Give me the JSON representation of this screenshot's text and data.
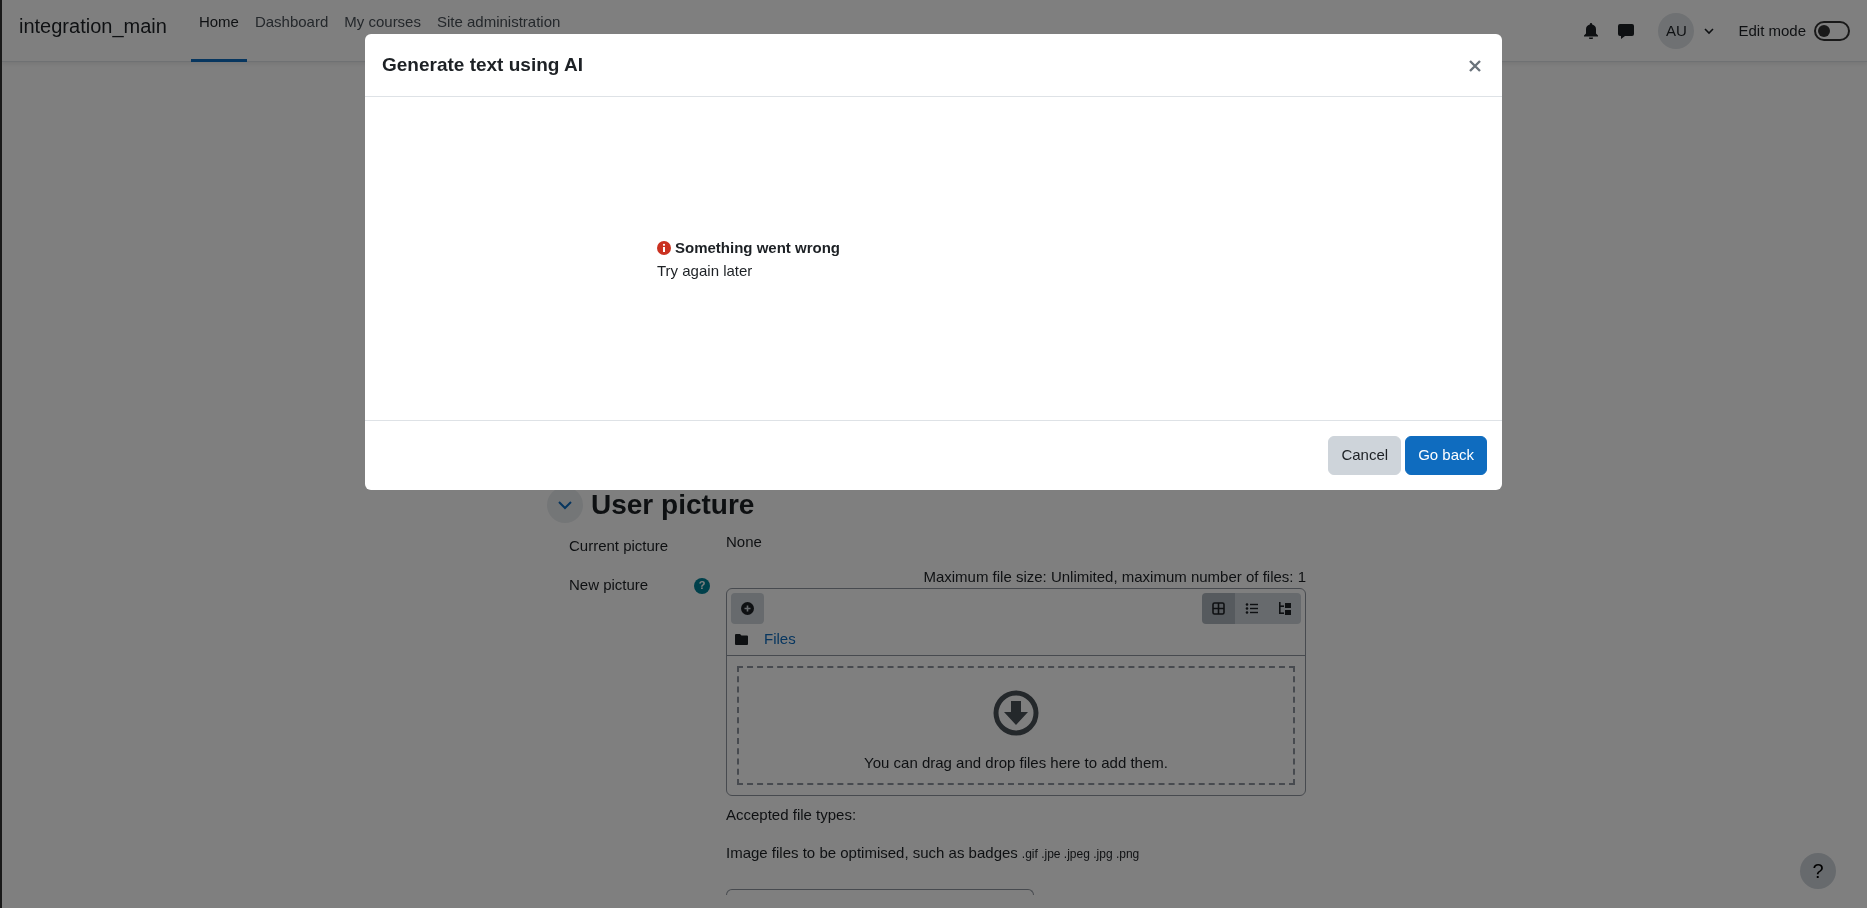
{
  "navbar": {
    "brand": "integration_main",
    "items": [
      {
        "label": "Home",
        "selected": true
      },
      {
        "label": "Dashboard",
        "selected": false
      },
      {
        "label": "My courses",
        "selected": false
      },
      {
        "label": "Site administration",
        "selected": false
      }
    ],
    "avatar": "AU",
    "edit_mode": {
      "label": "Edit mode",
      "on": false
    }
  },
  "section": {
    "title": "User picture",
    "expanded": true,
    "current_picture": {
      "label": "Current picture",
      "value": "None"
    },
    "new_picture": {
      "label": "New picture",
      "help": "?",
      "limits": "Maximum file size: Unlimited, maximum number of files: 1",
      "views": [
        {
          "kind": "grid",
          "selected": true
        },
        {
          "kind": "list",
          "selected": false
        },
        {
          "kind": "tree",
          "selected": false
        }
      ],
      "folder": "Files",
      "dropzone": "You can drag and drop files here to add them.",
      "accepted_label": "Accepted file types:",
      "accepted_description": "Image files to be optimised, such as badges",
      "extensions": ".gif .jpe .jpeg .jpg .png"
    }
  },
  "help_button": "?",
  "modal": {
    "title": "Generate text using AI",
    "error_title": "Something went wrong",
    "error_message": "Try again later",
    "buttons": [
      {
        "label": "Cancel",
        "kind": "secondary"
      },
      {
        "label": "Go back",
        "kind": "primary"
      }
    ]
  }
}
